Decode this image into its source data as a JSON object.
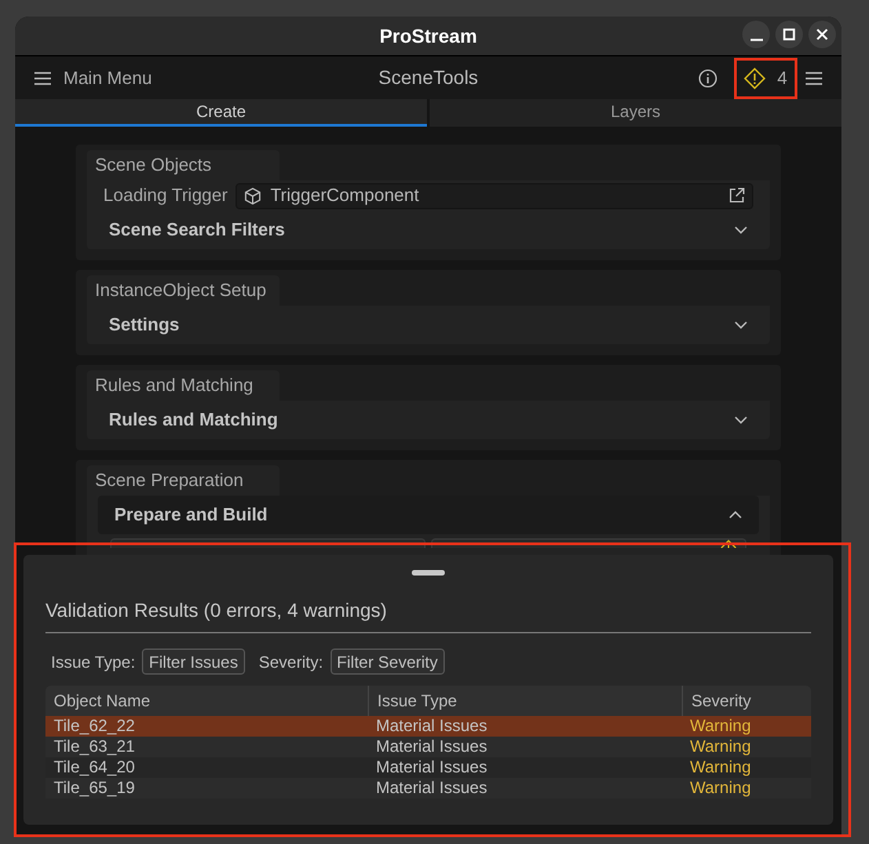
{
  "window": {
    "title": "ProStream"
  },
  "toolbar": {
    "menu_label": "Main Menu",
    "title": "SceneTools",
    "warning_count": "4"
  },
  "tabs": [
    {
      "label": "Create",
      "selected": true
    },
    {
      "label": "Layers",
      "selected": false
    }
  ],
  "sections": [
    {
      "title": "Scene Objects",
      "field": {
        "label": "Loading Trigger",
        "value": "TriggerComponent"
      },
      "foldout": {
        "label": "Scene Search Filters",
        "expanded": false
      }
    },
    {
      "title": "InstanceObject Setup",
      "foldout": {
        "label": "Settings",
        "expanded": false
      }
    },
    {
      "title": "Rules and Matching",
      "foldout": {
        "label": "Rules and Matching",
        "expanded": false
      }
    },
    {
      "title": "Scene Preparation",
      "foldout": {
        "label": "Prepare and Build",
        "expanded": true
      },
      "buttons": [
        {
          "warning": false
        },
        {
          "warning": true
        }
      ]
    }
  ],
  "validation": {
    "title": "Validation Results (0 errors, 4 warnings)",
    "filters": [
      {
        "label": "Issue Type:",
        "value": "Filter Issues"
      },
      {
        "label": "Severity:",
        "value": "Filter Severity"
      }
    ],
    "columns": [
      "Object Name",
      "Issue Type",
      "Severity"
    ],
    "rows": [
      {
        "cells": [
          "Tile_62_22",
          "Material Issues",
          "Warning"
        ],
        "selected": true
      },
      {
        "cells": [
          "Tile_63_21",
          "Material Issues",
          "Warning"
        ],
        "selected": false
      },
      {
        "cells": [
          "Tile_64_20",
          "Material Issues",
          "Warning"
        ],
        "selected": false
      },
      {
        "cells": [
          "Tile_65_19",
          "Material Issues",
          "Warning"
        ],
        "selected": false
      }
    ]
  }
}
